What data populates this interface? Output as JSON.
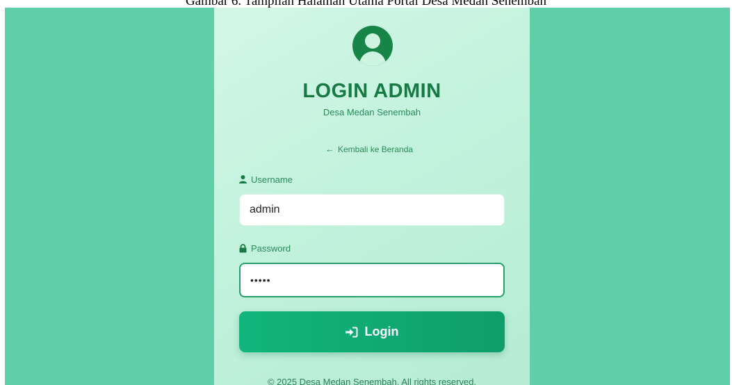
{
  "caption": "Gambar 6. Tampilan Halaman Utama Portal Desa Medan Senembah",
  "login": {
    "avatar_icon": "user-circle-icon",
    "title": "LOGIN ADMIN",
    "subtitle": "Desa Medan Senembah",
    "back_link": {
      "icon": "arrow-left-icon",
      "label": "Kembali ke Beranda"
    },
    "username": {
      "icon": "user-icon",
      "label": "Username",
      "value": "admin"
    },
    "password": {
      "icon": "lock-icon",
      "label": "Password",
      "value": "•••••"
    },
    "submit": {
      "icon": "sign-in-icon",
      "label": "Login"
    },
    "footer": "© 2025 Desa Medan Senembah. All rights reserved."
  },
  "colors": {
    "page_background": "#5ecfa9",
    "panel_background": "#c5f2de",
    "primary_green": "#167a42",
    "button_green": "#11b57c"
  }
}
